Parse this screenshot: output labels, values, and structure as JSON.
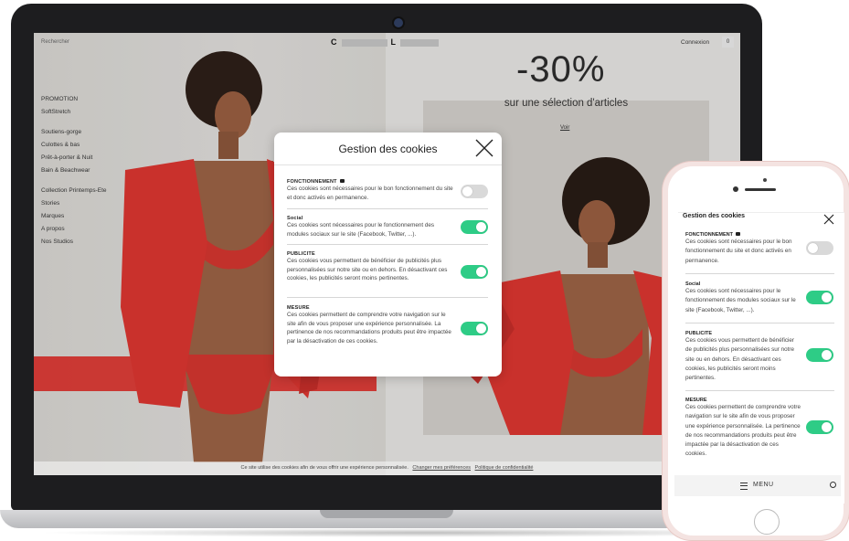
{
  "site": {
    "search_label": "Rechercher",
    "logo_left": "C",
    "logo_right": "L",
    "login_label": "Connexion",
    "cart_count": "0",
    "nav_items": [
      "PROMOTION",
      "SoftStretch",
      "Soutiens-gorge",
      "Culottes & bas",
      "Prêt-à-porter & Nuit",
      "Bain & Beachwear",
      "Collection Printemps-Ete",
      "Stories",
      "Marques",
      "A propos",
      "Nos Studios"
    ],
    "promo_big": "-30%",
    "promo_sub": "sur une sélection d'articles",
    "promo_link": "Voir",
    "cookie_bar_text": "Ce site utilise des cookies afin de vous offrir une expérience personnalisée.",
    "cookie_bar_link1": "Changer mes préférences",
    "cookie_bar_link2": "Politique de confidentialité"
  },
  "modal": {
    "title": "Gestion des cookies",
    "sections": [
      {
        "head": "FONCTIONNEMENT",
        "text": "Ces cookies sont nécessaires pour le bon fonctionnement du site et donc activés en permanence.",
        "enabled": false
      },
      {
        "head": "Social",
        "text": "Ces cookies sont nécessaires pour le fonctionnement des modules sociaux sur le site (Facebook, Twitter, ...).",
        "enabled": true
      },
      {
        "head": "PUBLICITE",
        "text": "Ces cookies vous permettent de bénéficier de publicités plus personnalisées sur notre site ou en dehors. En désactivant ces cookies, les publicités seront moins pertinentes.",
        "enabled": true
      },
      {
        "head": "MESURE",
        "text": "Ces cookies permettent de comprendre votre navigation sur le site afin de vous proposer une expérience personnalisée. La pertinence de nos recommandations produits peut être impactée par la désactivation de ces cookies.",
        "enabled": true
      }
    ]
  },
  "phone": {
    "title": "Gestion des cookies",
    "menu_label": "MENU"
  },
  "colors": {
    "toggle_on": "#2ecc86",
    "toggle_off": "#d9d9d9",
    "garment_red": "#e0322c"
  }
}
